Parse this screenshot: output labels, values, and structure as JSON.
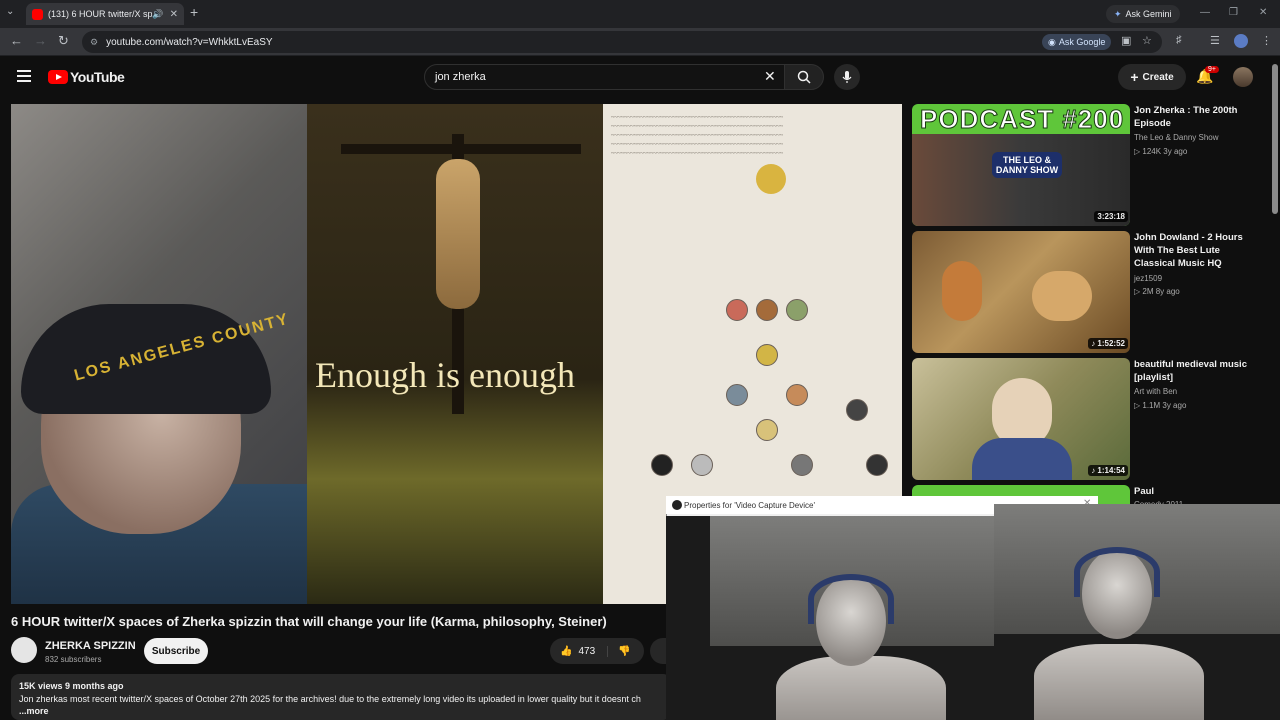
{
  "browser": {
    "tab_title": "(131) 6 HOUR twitter/X spaces",
    "ask_gemini": "Ask Gemini",
    "url": "youtube.com/watch?v=WhkktLvEaSY",
    "ask_google": "Ask Google"
  },
  "header": {
    "logo_text": "YouTube",
    "search_value": "jon zherka",
    "create_label": "Create",
    "notifications_badge": "9+"
  },
  "video": {
    "overlay_text": "Enough is enough",
    "cap_text": "LOS ANGELES COUNTY",
    "title": "6 HOUR twitter/X spaces of Zherka spizzin that will change your life (Karma, philosophy, Steiner)",
    "channel_name": "ZHERKA SPIZZIN",
    "subscribers": "832 subscribers",
    "subscribe_label": "Subscribe",
    "likes": "473",
    "views_time": "15K views  9 months ago",
    "description": "Jon zherkas most recent twitter/X spaces of October 27th 2025 for the archives! due to the extremely long video its uploaded in lower quality but it doesnt ch",
    "more_label": "...more"
  },
  "recommendations": [
    {
      "title": "Jon Zherka : The 200th Episode",
      "channel": "The Leo & Danny Show",
      "meta": "124K  3y ago",
      "duration": "3:23:18",
      "thumb_text": "PODCAST #200",
      "thumb_sub": "THE LEO & DANNY SHOW"
    },
    {
      "title": "John Dowland - 2 Hours With The Best Lute Classical Music HQ",
      "channel": "jez1509",
      "meta": "2M  8y ago",
      "duration": "1:52:52"
    },
    {
      "title": "beautiful medieval music [playlist]",
      "channel": "Art with Ben",
      "meta": "1.1M  3y ago",
      "duration": "1:14:54"
    },
    {
      "title": "Paul",
      "channel": "Comedy 2011",
      "meta": "",
      "duration": ""
    }
  ],
  "properties_window": {
    "title": "Properties for 'Video Capture Device'"
  },
  "colors": {
    "yt_red": "#ff0000",
    "background": "#0f0f0f",
    "podcast_green": "#5fc63a"
  }
}
